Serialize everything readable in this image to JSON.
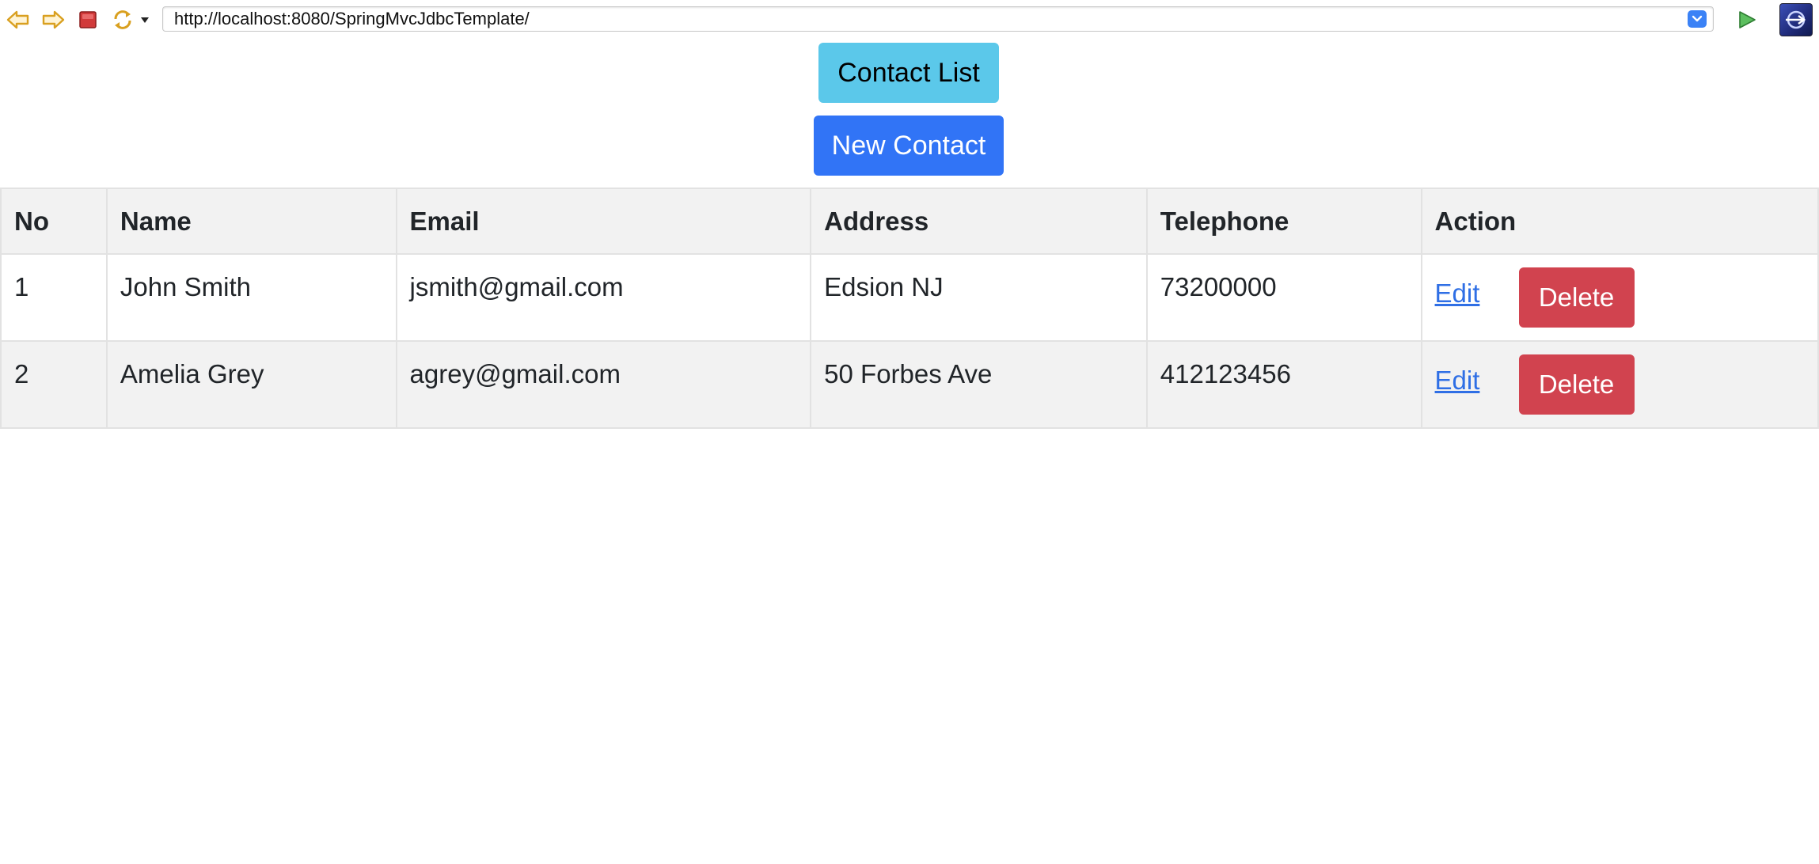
{
  "browser": {
    "url": "http://localhost:8080/SpringMvcJdbcTemplate/",
    "icons": {
      "back": "arrow-left-icon",
      "forward": "arrow-right-icon",
      "stop": "stop-icon",
      "reload": "reload-icon",
      "reload_menu": "dropdown-triangle-icon",
      "url_dropdown": "chevron-down-icon",
      "go": "play-icon",
      "app": "browser-logo-icon"
    },
    "colors": {
      "arrow": "#d9a020",
      "stop": "#d13a3a",
      "go": "#4caf50",
      "url_dropdown": "#3b82f6"
    }
  },
  "page": {
    "contact_list_label": "Contact List",
    "new_contact_label": "New Contact",
    "colors": {
      "contact_list_bg": "#5bc8ea",
      "new_contact_bg": "#3174f6",
      "delete_bg": "#d1434f",
      "link": "#2f6fe5"
    }
  },
  "table": {
    "headers": {
      "no": "No",
      "name": "Name",
      "email": "Email",
      "address": "Address",
      "telephone": "Telephone",
      "action": "Action"
    },
    "rows": [
      {
        "no": "1",
        "name": "John Smith",
        "email": "jsmith@gmail.com",
        "address": "Edsion NJ",
        "telephone": "73200000",
        "edit_label": "Edit",
        "delete_label": "Delete"
      },
      {
        "no": "2",
        "name": "Amelia Grey",
        "email": "agrey@gmail.com",
        "address": "50 Forbes Ave",
        "telephone": "412123456",
        "edit_label": "Edit",
        "delete_label": "Delete"
      }
    ]
  }
}
